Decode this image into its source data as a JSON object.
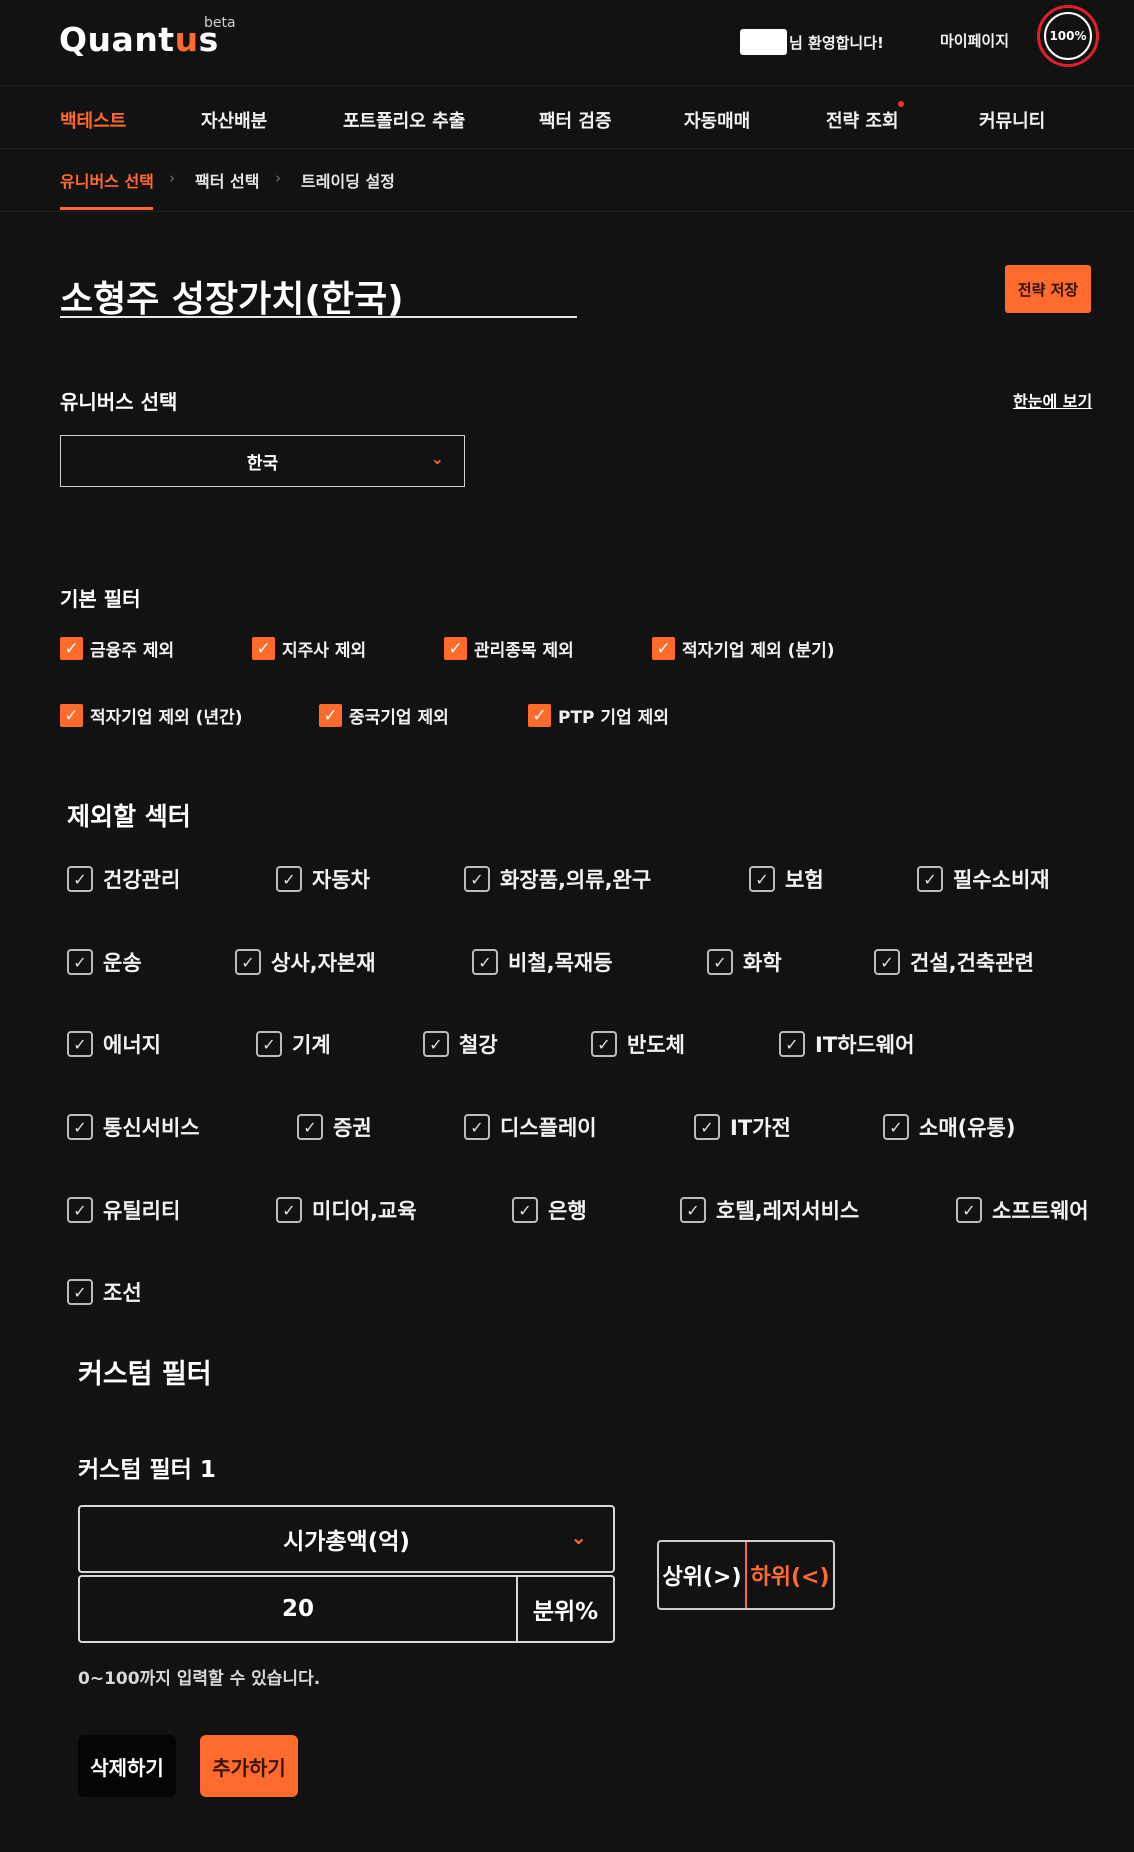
{
  "header": {
    "logo_prefix": "Quant",
    "logo_accent": "u",
    "logo_suffix": "s",
    "logo_badge": "beta",
    "welcome_text": "님 환영합니다!",
    "mypage_label": "마이페이지",
    "progress_percent": 100,
    "progress_label": "100%",
    "accent_color": "#ff6b2c"
  },
  "nav": {
    "items": [
      {
        "label": "백테스트",
        "active": true
      },
      {
        "label": "자산배분"
      },
      {
        "label": "포트폴리오 추출"
      },
      {
        "label": "팩터 검증"
      },
      {
        "label": "자동매매"
      },
      {
        "label": "전략 조회",
        "has_notification_dot": true
      },
      {
        "label": "커뮤니티"
      }
    ]
  },
  "subnav": {
    "items": [
      {
        "label": "유니버스 선택",
        "active": true
      },
      {
        "label": "팩터 선택"
      },
      {
        "label": "트레이딩 설정"
      }
    ],
    "separator_icon": "chevron-right-icon"
  },
  "strategy": {
    "title": "소형주 성장가치(한국)",
    "save_label": "전략 저장"
  },
  "universe": {
    "heading": "유니버스 선택",
    "view_all_label": "한눈에 보기",
    "selected": "한국"
  },
  "basic_filter": {
    "heading": "기본 필터",
    "items": [
      {
        "label": "금융주 제외",
        "checked": true
      },
      {
        "label": "지주사 제외",
        "checked": true
      },
      {
        "label": "관리종목 제외",
        "checked": true
      },
      {
        "label": "적자기업 제외 (분기)",
        "checked": true
      },
      {
        "label": "적자기업 제외 (년간)",
        "checked": true
      },
      {
        "label": "중국기업 제외",
        "checked": true
      },
      {
        "label": "PTP 기업 제외",
        "checked": true
      }
    ]
  },
  "sectors": {
    "heading": "제외할 섹터",
    "items": [
      {
        "label": "건강관리",
        "checked": true
      },
      {
        "label": "자동차",
        "checked": true
      },
      {
        "label": "화장품,의류,완구",
        "checked": true
      },
      {
        "label": "보험",
        "checked": true
      },
      {
        "label": "필수소비재",
        "checked": true
      },
      {
        "label": "운송",
        "checked": true
      },
      {
        "label": "상사,자본재",
        "checked": true
      },
      {
        "label": "비철,목재등",
        "checked": true
      },
      {
        "label": "화학",
        "checked": true
      },
      {
        "label": "건설,건축관련",
        "checked": true
      },
      {
        "label": "에너지",
        "checked": true
      },
      {
        "label": "기계",
        "checked": true
      },
      {
        "label": "철강",
        "checked": true
      },
      {
        "label": "반도체",
        "checked": true
      },
      {
        "label": "IT하드웨어",
        "checked": true
      },
      {
        "label": "통신서비스",
        "checked": true
      },
      {
        "label": "증권",
        "checked": true
      },
      {
        "label": "디스플레이",
        "checked": true
      },
      {
        "label": "IT가전",
        "checked": true
      },
      {
        "label": "소매(유통)",
        "checked": true
      },
      {
        "label": "유틸리티",
        "checked": true
      },
      {
        "label": "미디어,교육",
        "checked": true
      },
      {
        "label": "은행",
        "checked": true
      },
      {
        "label": "호텔,레저서비스",
        "checked": true
      },
      {
        "label": "소프트웨어",
        "checked": true
      },
      {
        "label": "조선",
        "checked": true
      }
    ]
  },
  "custom_filter": {
    "heading": "커스텀 필터",
    "filter_title": "커스텀 필터 1",
    "metric": "시가총액(억)",
    "value": "20",
    "unit": "분위%",
    "upper_label": "상위(>)",
    "lower_label": "하위(<)",
    "selected_direction": "lower",
    "hint": "0~100까지 입력할 수 있습니다.",
    "delete_label": "삭제하기",
    "add_label": "추가하기"
  }
}
